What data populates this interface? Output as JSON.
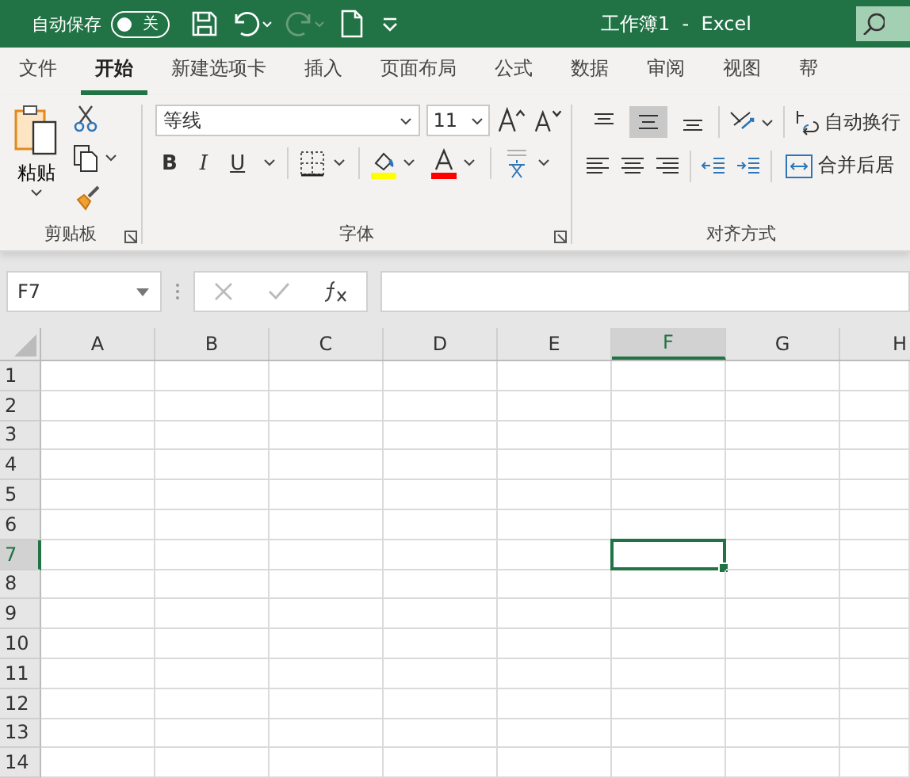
{
  "title_bar": {
    "autosave_label": "自动保存",
    "autosave_toggle": {
      "on": false,
      "label": "关"
    },
    "title": "工作簿1  -  Excel"
  },
  "tabs": [
    {
      "label": "文件",
      "selected": false
    },
    {
      "label": "开始",
      "selected": true
    },
    {
      "label": "新建选项卡",
      "selected": false
    },
    {
      "label": "插入",
      "selected": false
    },
    {
      "label": "页面布局",
      "selected": false
    },
    {
      "label": "公式",
      "selected": false
    },
    {
      "label": "数据",
      "selected": false
    },
    {
      "label": "审阅",
      "selected": false
    },
    {
      "label": "视图",
      "selected": false
    },
    {
      "label": "帮",
      "selected": false
    }
  ],
  "ribbon": {
    "clipboard": {
      "label": "剪贴板",
      "paste": "粘贴"
    },
    "font": {
      "label": "字体",
      "font_name": "等线",
      "font_size": "11",
      "bold": "B",
      "italic": "I",
      "underline": "U"
    },
    "alignment": {
      "label": "对齐方式",
      "vertical_align": [
        {
          "selected": false
        },
        {
          "selected": true
        },
        {
          "selected": false
        }
      ],
      "wrap_text": "自动换行",
      "merge": "合并后居"
    }
  },
  "formula_bar": {
    "name_box": "F7"
  },
  "grid": {
    "columns": [
      {
        "label": "A",
        "selected": false
      },
      {
        "label": "B",
        "selected": false
      },
      {
        "label": "C",
        "selected": false
      },
      {
        "label": "D",
        "selected": false
      },
      {
        "label": "E",
        "selected": false
      },
      {
        "label": "F",
        "selected": true
      },
      {
        "label": "G",
        "selected": false
      },
      {
        "label": "H",
        "selected": false
      }
    ],
    "rows": [
      {
        "label": "1",
        "selected": false
      },
      {
        "label": "2",
        "selected": false
      },
      {
        "label": "3",
        "selected": false
      },
      {
        "label": "4",
        "selected": false
      },
      {
        "label": "5",
        "selected": false
      },
      {
        "label": "6",
        "selected": false
      },
      {
        "label": "7",
        "selected": true
      },
      {
        "label": "8",
        "selected": false
      },
      {
        "label": "9",
        "selected": false
      },
      {
        "label": "10",
        "selected": false
      },
      {
        "label": "11",
        "selected": false
      },
      {
        "label": "12",
        "selected": false
      },
      {
        "label": "13",
        "selected": false
      },
      {
        "label": "14",
        "selected": false
      }
    ]
  }
}
